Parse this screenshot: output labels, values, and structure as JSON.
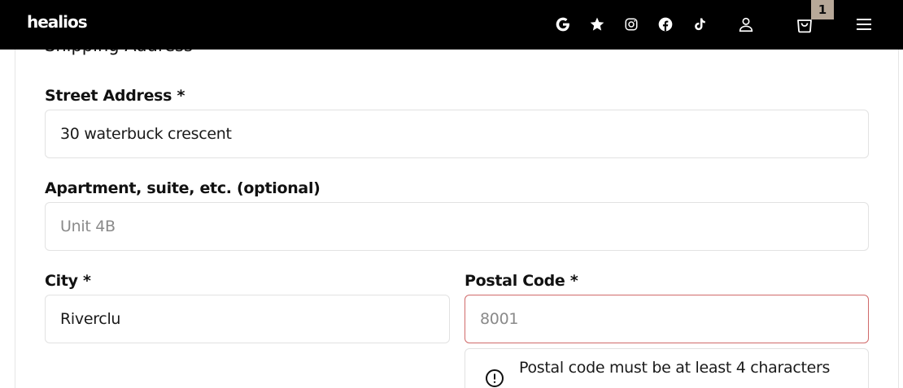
{
  "header": {
    "logo": "healios",
    "icons": [
      "google-icon",
      "star-icon",
      "instagram-icon",
      "facebook-icon",
      "tiktok-icon",
      "user-icon",
      "cart-icon",
      "menu-icon"
    ],
    "cart_count": "1"
  },
  "form": {
    "section_title": "Shipping Address",
    "street": {
      "label": "Street Address *",
      "value": "30 waterbuck crescent"
    },
    "apartment": {
      "label": "Apartment, suite, etc. (optional)",
      "placeholder": "Unit 4B"
    },
    "city": {
      "label": "City *",
      "value": "Riverclu"
    },
    "postal": {
      "label": "Postal Code *",
      "placeholder": "8001",
      "error": "Postal code must be at least 4 characters"
    }
  },
  "colors": {
    "header_bg": "#000000",
    "badge_bg": "#b7a898",
    "error_border": "#d06a6a"
  }
}
